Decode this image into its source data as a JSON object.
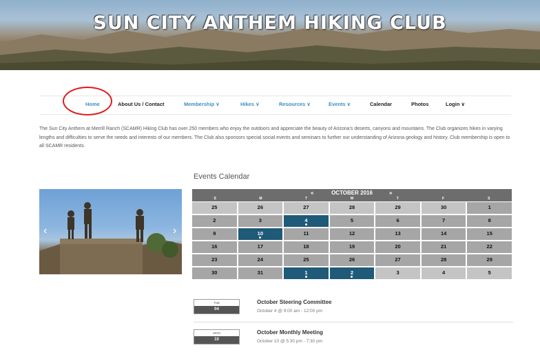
{
  "site": {
    "title": "SUN CITY ANTHEM HIKING CLUB"
  },
  "nav": {
    "items": [
      {
        "label": "Home"
      },
      {
        "label": "About Us / Contact"
      },
      {
        "label": "Membership ∨"
      },
      {
        "label": "Hikes ∨"
      },
      {
        "label": "Resources ∨"
      },
      {
        "label": "Events ∨"
      },
      {
        "label": "Calendar"
      },
      {
        "label": "Photos"
      },
      {
        "label": "Login ∨"
      }
    ]
  },
  "intro": {
    "text": "The Sun City Anthem at Merrill Ranch (SCAMR) Hiking Club has over 250 members who enjoy the outdoors and appreciate the beauty of Arizona's deserts, canyons and mountains.  The Club organizes hikes in varying lengths and difficulties to serve the needs and interests of our members.  The Club also sponsors special social events and seminars to further our understanding of Arizona geology and history.  Club membership is open to all SCAMR residents."
  },
  "slider": {
    "prev_glyph": "‹",
    "next_glyph": "›"
  },
  "events_calendar": {
    "heading": "Events Calendar",
    "prev": "«",
    "month": "OCTOBER 2016",
    "next": "»",
    "weekdays": [
      "S",
      "M",
      "T",
      "W",
      "T",
      "F",
      "S"
    ],
    "weeks": [
      [
        "25",
        "26",
        "27",
        "28",
        "29",
        "30",
        "1"
      ],
      [
        "2",
        "3",
        "4",
        "5",
        "6",
        "7",
        "8"
      ],
      [
        "9",
        "10",
        "11",
        "12",
        "13",
        "14",
        "15"
      ],
      [
        "16",
        "17",
        "18",
        "19",
        "20",
        "21",
        "22"
      ],
      [
        "23",
        "24",
        "25",
        "26",
        "27",
        "28",
        "29"
      ],
      [
        "30",
        "31",
        "1",
        "2",
        "3",
        "4",
        "5"
      ]
    ]
  },
  "events": [
    {
      "dow": "TUE",
      "day": "04",
      "title": "October Steering Committee",
      "time": "October 4 @ 9:00 am - 12:00 pm"
    },
    {
      "dow": "MON",
      "day": "10",
      "title": "October Monthly Meeting",
      "time": "October 10 @ 5:30 pm - 7:30 pm"
    }
  ],
  "colors": {
    "nav_accent": "#3b8fc6",
    "event_day": "#1f5a78",
    "calendar_header": "#6d6d6d",
    "highlight_circle": "#e0191b"
  }
}
